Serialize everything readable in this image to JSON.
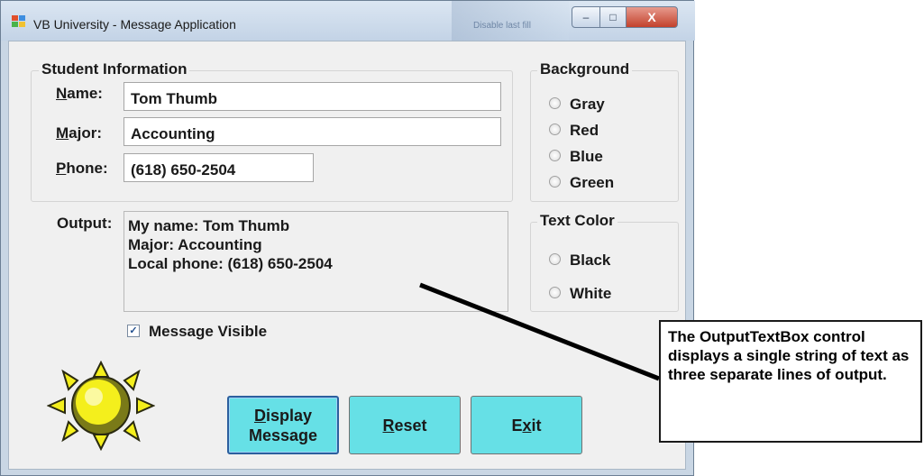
{
  "window": {
    "title": "VB University - Message Application",
    "ghost_text": "Disable last fill",
    "caption_buttons": {
      "minimize": "–",
      "maximize": "□",
      "close": "X"
    }
  },
  "student_group": {
    "legend": "Student Information",
    "name_label": "Name:",
    "name_label_mnemonic": "N",
    "name_label_rest": "ame:",
    "name_value": "Tom Thumb",
    "major_label_mnemonic": "M",
    "major_label_rest": "ajor:",
    "major_value": "Accounting",
    "phone_label_mnemonic": "P",
    "phone_label_rest": "hone:",
    "phone_value": "(618) 650-2504"
  },
  "output": {
    "label": "Output:",
    "lines": [
      "My name: Tom Thumb",
      "Major: Accounting",
      "Local phone: (618) 650-2504"
    ]
  },
  "background_group": {
    "legend": "Background",
    "options": [
      "Gray",
      "Red",
      "Blue",
      "Green"
    ]
  },
  "text_color_group": {
    "legend": "Text Color",
    "options": [
      "Black",
      "White"
    ]
  },
  "message_visible": {
    "label": "Message Visible",
    "checked": true,
    "check_mark": "✓"
  },
  "buttons": {
    "display_mnemonic": "D",
    "display_rest_line1": "isplay",
    "display_line2": "Message",
    "reset_mnemonic": "R",
    "reset_rest": "eset",
    "exit_first": "E",
    "exit_mnemonic": "x",
    "exit_rest": "it"
  },
  "callout": {
    "text": "The OutputTextBox control displays a single string of text as three separate lines of output."
  },
  "colors": {
    "button_fill": "#66e0e6",
    "sun_yellow": "#f4ef1c",
    "sun_dark": "#7a7a18",
    "titlebar": "#c9d6e4",
    "form_bg": "#f0f0f0"
  },
  "icons": [
    "app-icon",
    "sun-icon",
    "radio-icon",
    "checkbox-icon"
  ]
}
